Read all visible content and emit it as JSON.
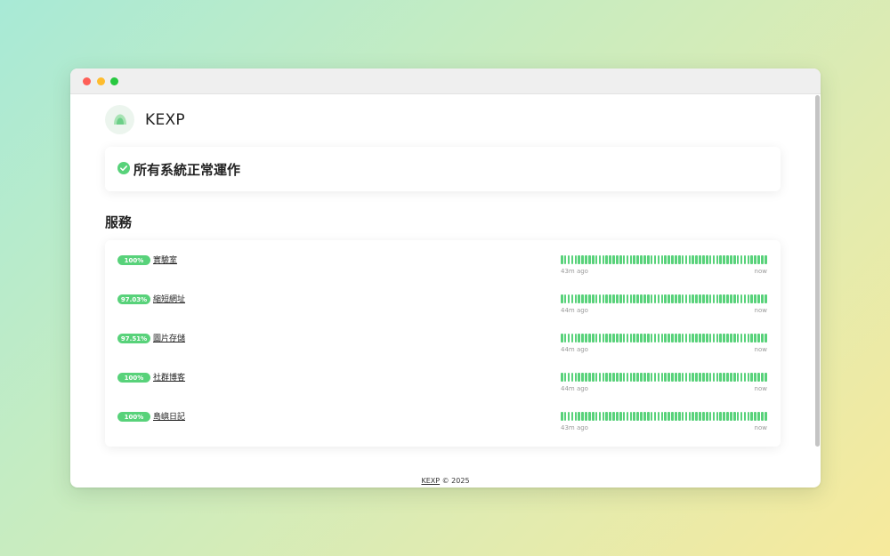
{
  "brand": {
    "name": "KEXP"
  },
  "status": {
    "message": "所有系統正常運作",
    "color": "#58d27a"
  },
  "section_title": "服務",
  "services": [
    {
      "uptime": "100%",
      "name": "實驗室",
      "start_label": "43m ago",
      "end_label": "now"
    },
    {
      "uptime": "97.03%",
      "name": "縮短網址",
      "start_label": "44m ago",
      "end_label": "now"
    },
    {
      "uptime": "97.51%",
      "name": "圖片存儲",
      "start_label": "44m ago",
      "end_label": "now"
    },
    {
      "uptime": "100%",
      "name": "社群博客",
      "start_label": "44m ago",
      "end_label": "now"
    },
    {
      "uptime": "100%",
      "name": "島嶼日記",
      "start_label": "43m ago",
      "end_label": "now"
    }
  ],
  "footer": {
    "link": "KEXP",
    "text": "© 2025"
  },
  "colors": {
    "accent": "#58d27a",
    "window_chrome": "#efefef"
  }
}
